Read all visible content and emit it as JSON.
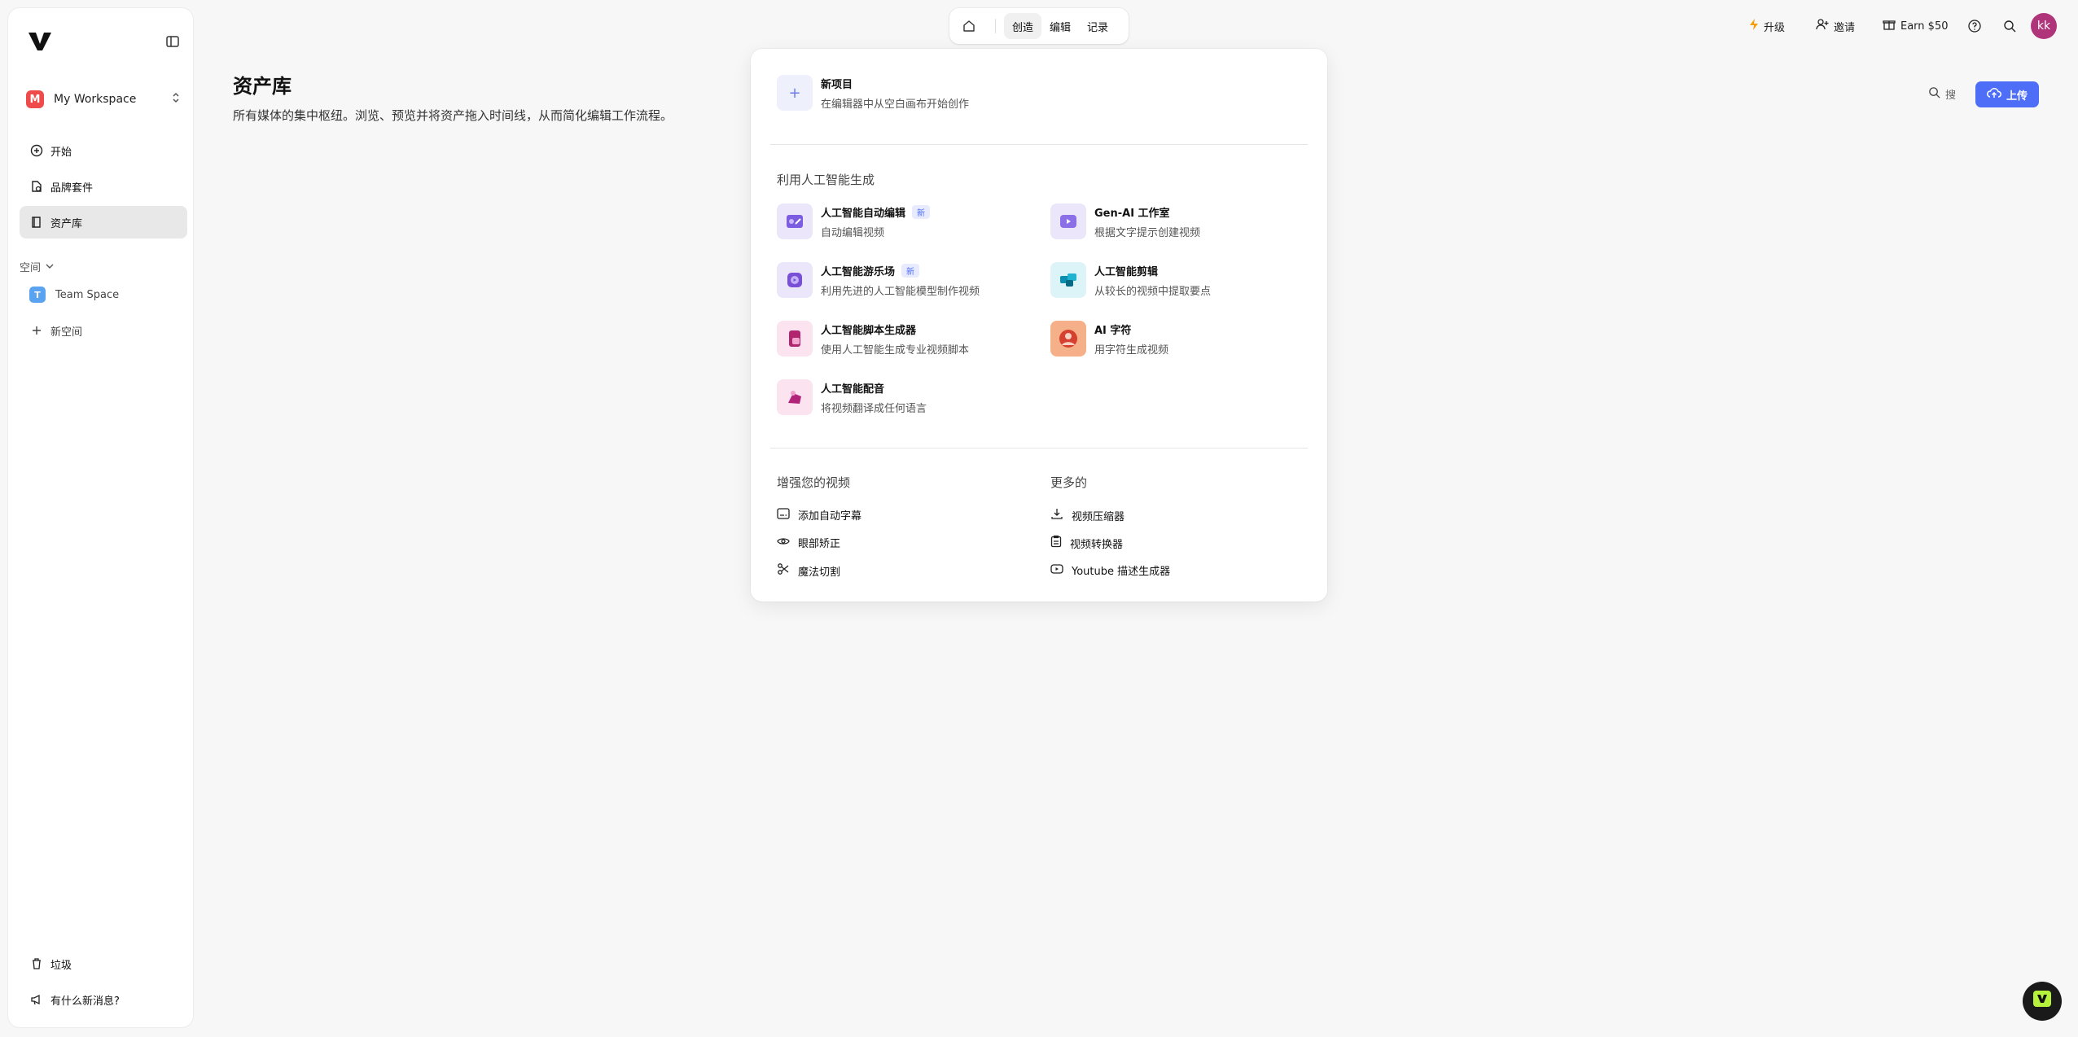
{
  "sidebar": {
    "workspace": {
      "initial": "M",
      "name": "My Workspace"
    },
    "nav": [
      {
        "label": "开始",
        "icon": "plus-circle-icon"
      },
      {
        "label": "品牌套件",
        "icon": "brand-kit-icon"
      },
      {
        "label": "资产库",
        "icon": "library-icon"
      }
    ],
    "spaces_header": "空间",
    "spaces": [
      {
        "initial": "T",
        "name": "Team Space"
      }
    ],
    "new_space": "新空间",
    "trash": "垃圾",
    "whats_new": "有什么新消息?"
  },
  "topnav": {
    "tabs": [
      "创造",
      "编辑",
      "记录"
    ],
    "active": "创造"
  },
  "topright": {
    "upgrade": "升级",
    "invite": "邀请",
    "earn": "Earn $50",
    "avatar": "kk"
  },
  "page": {
    "title": "资产库",
    "subtitle": "所有媒体的集中枢纽。浏览、预览并将资产拖入时间线，从而简化编辑工作流程。",
    "search_label": "搜",
    "upload_label": "上传"
  },
  "panel": {
    "new_project": {
      "title": "新项目",
      "desc": "在编辑器中从空白画布开始创作"
    },
    "ai_section": "利用人工智能生成",
    "ai_items": [
      {
        "title": "人工智能自动编辑",
        "desc": "自动编辑视频",
        "badge": "新"
      },
      {
        "title": "Gen-AI 工作室",
        "desc": "根据文字提示创建视频"
      },
      {
        "title": "人工智能游乐场",
        "desc": "利用先进的人工智能模型制作视频",
        "badge": "新"
      },
      {
        "title": "人工智能剪辑",
        "desc": "从较长的视频中提取要点"
      },
      {
        "title": "人工智能脚本生成器",
        "desc": "使用人工智能生成专业视频脚本"
      },
      {
        "title": "AI 字符",
        "desc": "用字符生成视频"
      },
      {
        "title": "人工智能配音",
        "desc": "将视频翻译成任何语言"
      }
    ],
    "enhance_section": "增强您的视频",
    "enhance_items": [
      "添加自动字幕",
      "眼部矫正",
      "魔法切割"
    ],
    "more_section": "更多的",
    "more_items": [
      "视频压缩器",
      "视频转换器",
      "Youtube 描述生成器"
    ]
  },
  "colors": {
    "accent": "#4f6ef7",
    "workspace_avatar": "#ef4b4b",
    "space_avatar": "#5aa3f0",
    "user_avatar": "#b0347a",
    "upgrade_icon": "#f59e0b"
  }
}
